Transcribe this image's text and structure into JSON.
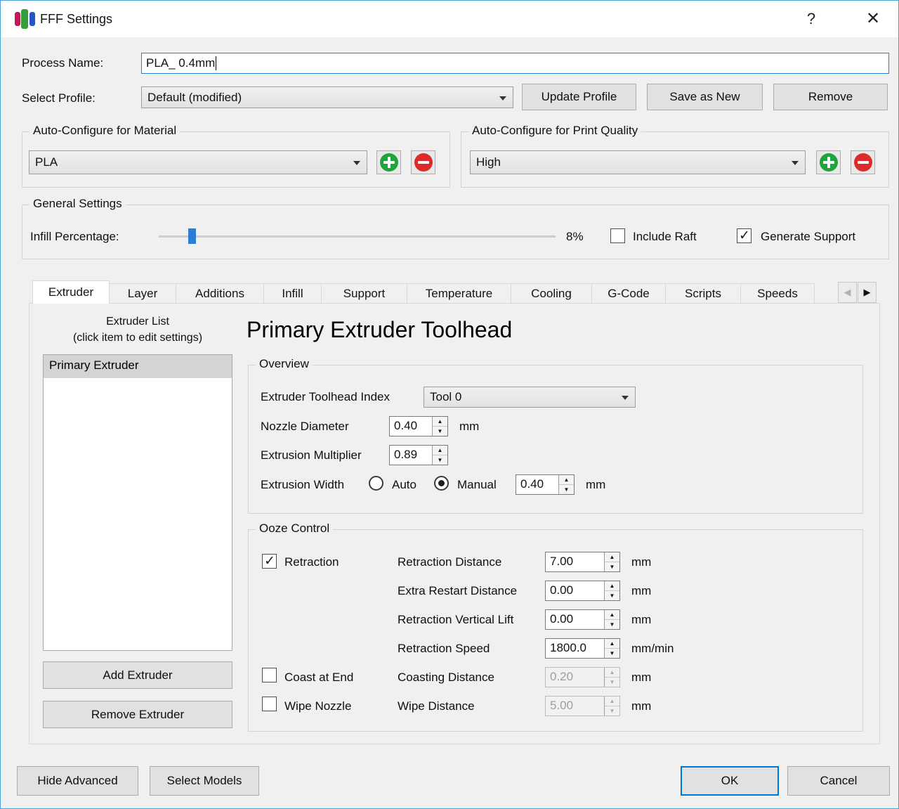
{
  "window": {
    "title": "FFF Settings",
    "help_icon": "?",
    "close_icon": "✕"
  },
  "header": {
    "process_name_label": "Process Name:",
    "process_name_value": "PLA_ 0.4mm",
    "select_profile_label": "Select Profile:",
    "select_profile_value": "Default (modified)",
    "update_profile_label": "Update Profile",
    "save_as_new_label": "Save as New",
    "remove_label": "Remove"
  },
  "auto_material": {
    "title": "Auto-Configure for Material",
    "selected": "PLA"
  },
  "auto_quality": {
    "title": "Auto-Configure for Print Quality",
    "selected": "High"
  },
  "general": {
    "title": "General Settings",
    "infill_label": "Infill Percentage:",
    "infill_value": "8%",
    "include_raft_label": "Include Raft",
    "include_raft_checked": false,
    "generate_support_label": "Generate Support",
    "generate_support_checked": true
  },
  "tabs": [
    "Extruder",
    "Layer",
    "Additions",
    "Infill",
    "Support",
    "Temperature",
    "Cooling",
    "G-Code",
    "Scripts",
    "Speeds"
  ],
  "active_tab": "Extruder",
  "tab_scroll": {
    "left_icon": "◀",
    "right_icon": "▶"
  },
  "extruder_list": {
    "title_line1": "Extruder List",
    "title_line2": "(click item to edit settings)",
    "items": [
      "Primary Extruder"
    ],
    "selected_item": "Primary Extruder",
    "add_label": "Add Extruder",
    "remove_label": "Remove Extruder"
  },
  "toolhead": {
    "title": "Primary Extruder Toolhead",
    "overview": {
      "title": "Overview",
      "index_label": "Extruder Toolhead Index",
      "index_value": "Tool 0",
      "nozzle_label": "Nozzle Diameter",
      "nozzle_value": "0.40",
      "nozzle_unit": "mm",
      "multiplier_label": "Extrusion Multiplier",
      "multiplier_value": "0.89",
      "width_label": "Extrusion Width",
      "width_auto_label": "Auto",
      "width_manual_label": "Manual",
      "width_mode": "Manual",
      "width_value": "0.40",
      "width_unit": "mm"
    },
    "ooze": {
      "title": "Ooze Control",
      "retraction_label": "Retraction",
      "retraction_checked": true,
      "coast_label": "Coast at End",
      "coast_checked": false,
      "wipe_label": "Wipe Nozzle",
      "wipe_checked": false,
      "rows": [
        {
          "label": "Retraction Distance",
          "value": "7.00",
          "unit": "mm",
          "enabled": true
        },
        {
          "label": "Extra Restart Distance",
          "value": "0.00",
          "unit": "mm",
          "enabled": true
        },
        {
          "label": "Retraction Vertical Lift",
          "value": "0.00",
          "unit": "mm",
          "enabled": true
        },
        {
          "label": "Retraction Speed",
          "value": "1800.0",
          "unit": "mm/min",
          "enabled": true
        },
        {
          "label": "Coasting Distance",
          "value": "0.20",
          "unit": "mm",
          "enabled": false
        },
        {
          "label": "Wipe Distance",
          "value": "5.00",
          "unit": "mm",
          "enabled": false
        }
      ]
    }
  },
  "footer": {
    "hide_advanced_label": "Hide Advanced",
    "select_models_label": "Select Models",
    "ok_label": "OK",
    "cancel_label": "Cancel"
  },
  "colors": {
    "accent_blue": "#0078d7",
    "slider_handle": "#2d7dd2",
    "add_green": "#1fa33c",
    "remove_red": "#dd2b2b",
    "window_border": "#49a0da"
  }
}
